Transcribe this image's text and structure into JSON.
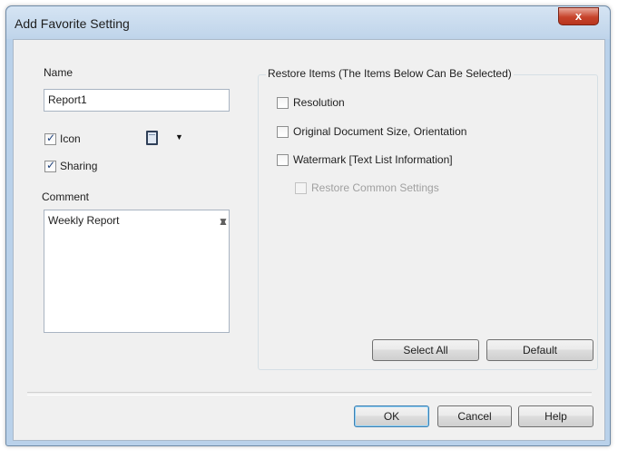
{
  "window": {
    "title": "Add Favorite Setting",
    "close_glyph": "x"
  },
  "left": {
    "name_label": "Name",
    "name_value": "Report1",
    "icon_label": "Icon",
    "icon_checked": true,
    "sharing_label": "Sharing",
    "sharing_checked": true,
    "comment_label": "Comment",
    "comment_value": "Weekly Report",
    "icon_combo_arrow": "▼"
  },
  "restore": {
    "group_title": "Restore Items (The Items Below Can Be Selected)",
    "items": [
      {
        "label": "Resolution",
        "checked": false,
        "enabled": true
      },
      {
        "label": "Original Document Size, Orientation",
        "checked": false,
        "enabled": true
      },
      {
        "label": "Watermark [Text List Information]",
        "checked": false,
        "enabled": true
      },
      {
        "label": "Restore Common Settings",
        "checked": false,
        "enabled": false
      }
    ],
    "select_all_label": "Select All",
    "default_label": "Default"
  },
  "footer": {
    "ok_label": "OK",
    "cancel_label": "Cancel",
    "help_label": "Help"
  },
  "scroll": {
    "up": "▲",
    "down": "▼"
  }
}
